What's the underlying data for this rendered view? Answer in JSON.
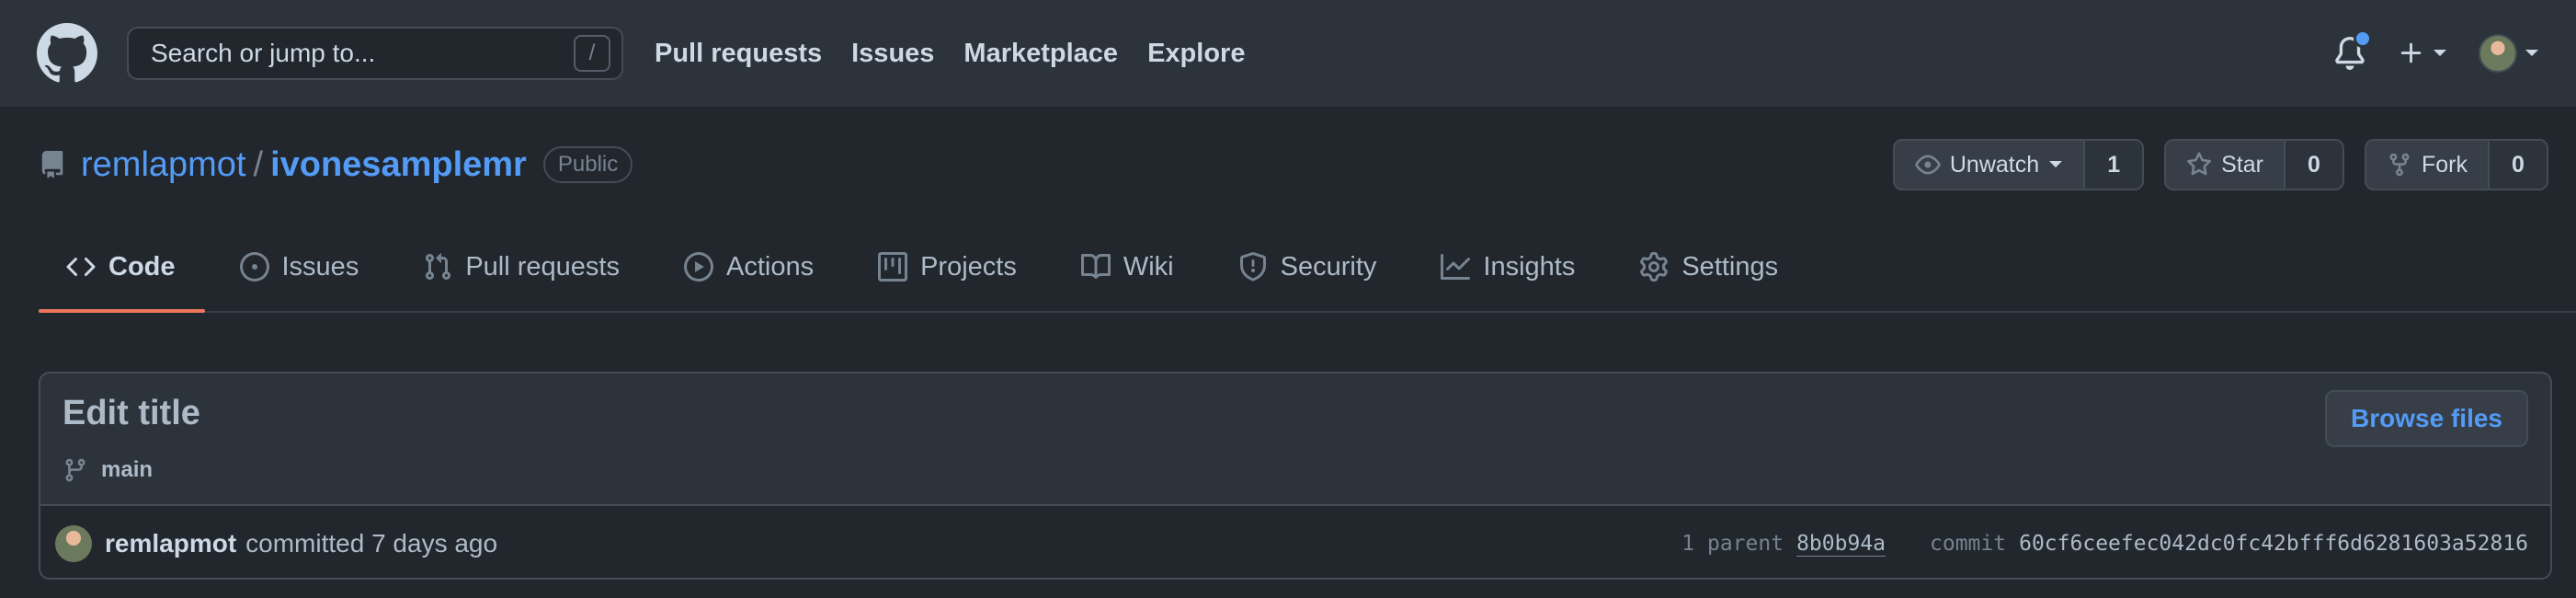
{
  "header": {
    "search_placeholder": "Search or jump to...",
    "slash_key": "/",
    "nav": [
      "Pull requests",
      "Issues",
      "Marketplace",
      "Explore"
    ]
  },
  "repo": {
    "owner": "remlapmot",
    "separator": "/",
    "name": "ivonesamplemr",
    "visibility": "Public",
    "unwatch_label": "Unwatch",
    "watch_count": "1",
    "star_label": "Star",
    "star_count": "0",
    "fork_label": "Fork",
    "fork_count": "0"
  },
  "tabs": {
    "code": "Code",
    "issues": "Issues",
    "pull_requests": "Pull requests",
    "actions": "Actions",
    "projects": "Projects",
    "wiki": "Wiki",
    "security": "Security",
    "insights": "Insights",
    "settings": "Settings"
  },
  "commit": {
    "title": "Edit title",
    "branch": "main",
    "browse_files": "Browse files",
    "author": "remlapmot",
    "committed_text": "committed 7 days ago",
    "parent_label": "1 parent",
    "parent_sha": "8b0b94a",
    "commit_label": "commit",
    "commit_sha": "60cf6ceefec042dc0fc42bfff6d6281603a52816"
  },
  "colors": {
    "accent_link": "#539bf5",
    "tab_underline": "#ec775c",
    "notification_dot": "#539bf5"
  }
}
